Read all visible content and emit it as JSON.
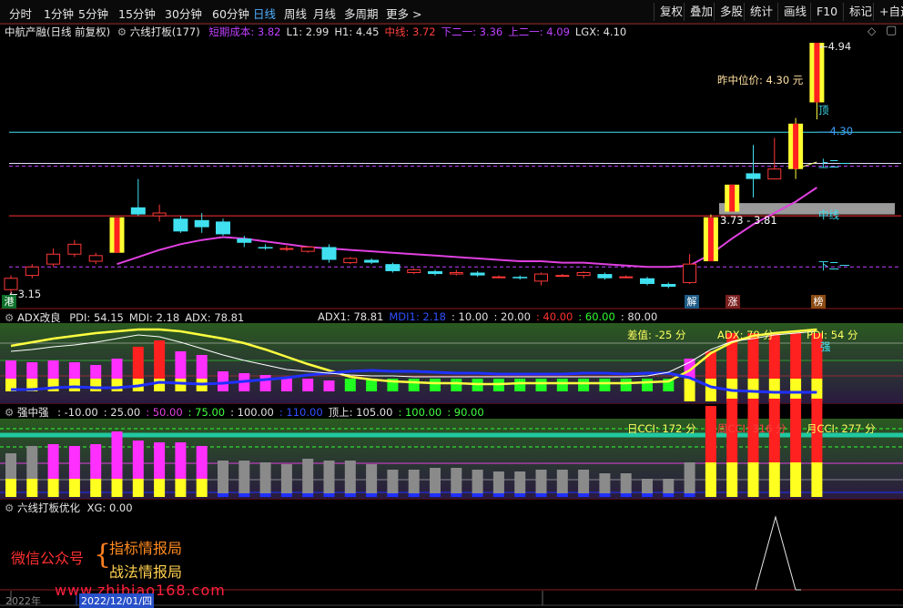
{
  "toolbar": {
    "periods": [
      "分时",
      "1分钟",
      "5分钟",
      "15分钟",
      "30分钟",
      "60分钟",
      "日线",
      "周线",
      "月线",
      "多周期",
      "更多 >"
    ],
    "active_period": "日线",
    "right_buttons": [
      "复权",
      "叠加",
      "多股",
      "统计",
      "画线",
      "F10",
      "标记",
      "+自选"
    ]
  },
  "main_panel": {
    "stock_title": "中航产融(日线 前复权)",
    "indicator_name": "六线打板(177)",
    "params": [
      {
        "text": "短期成本: 3.82",
        "color": "#c040ff"
      },
      {
        "text": "L1: 2.99",
        "color": "#e0e0e0"
      },
      {
        "text": "H1: 4.45",
        "color": "#e0e0e0"
      },
      {
        "text": "中线: 3.72",
        "color": "#ff4040"
      },
      {
        "text": "下二一: 3.36",
        "color": "#c040ff"
      },
      {
        "text": "上二一: 4.09",
        "color": "#c040ff"
      },
      {
        "text": "LGX: 4.10",
        "color": "#e0e0e0"
      }
    ],
    "high_label": "4.94",
    "low_label": "3.15",
    "mid_price_label": "昨中位价:  4.30 元",
    "top_label": "顶",
    "level_430": "---4.30",
    "upper_label": "上二一",
    "mid_label": "中线",
    "lower_label": "下二一",
    "range_label": "3.73 - 3.81",
    "badge_left": "港",
    "badges": [
      "解",
      "涨",
      "榜"
    ]
  },
  "adx_panel": {
    "name": "ADX改良",
    "values": [
      {
        "text": "PDI: 54.15",
        "color": "#e0e0e0"
      },
      {
        "text": "MDI: 2.18",
        "color": "#e0e0e0"
      },
      {
        "text": "ADX: 78.81",
        "color": "#e0e0e0"
      }
    ],
    "levels": [
      {
        "text": "ADX1: 78.81",
        "color": "#e0e0e0"
      },
      {
        "text": "MDI1: 2.18",
        "color": "#3050ff"
      },
      {
        "text": ": 10.00",
        "color": "#e0e0e0"
      },
      {
        "text": ": 20.00",
        "color": "#e0e0e0"
      },
      {
        "text": ": 40.00",
        "color": "#ff3030"
      },
      {
        "text": ": 60.00",
        "color": "#30ff30"
      },
      {
        "text": ": 80.00",
        "color": "#e0e0e0"
      }
    ],
    "diff_label": "差值: -25 分",
    "adx_score": "ADX: 79 分",
    "pdi_score": "PDI: 54 分",
    "strong": "强"
  },
  "cci_panel": {
    "name": "强中强",
    "levels": [
      {
        "text": ": -10.00",
        "color": "#e0e0e0"
      },
      {
        "text": ": 25.00",
        "color": "#e0e0e0"
      },
      {
        "text": ": 50.00",
        "color": "#e040e0"
      },
      {
        "text": ": 75.00",
        "color": "#40ff40"
      },
      {
        "text": ": 100.00",
        "color": "#e0e0e0"
      },
      {
        "text": ": 110.00",
        "color": "#3050ff"
      },
      {
        "text": "顶上: 105.00",
        "color": "#e0e0e0"
      },
      {
        "text": ": 100.00",
        "color": "#40ff40"
      },
      {
        "text": ": 90.00",
        "color": "#40ff40"
      }
    ],
    "day_cci": "日CCI: 172 分",
    "week_cci": "周CCI: 316 分",
    "month_cci": "月CCI: 277 分"
  },
  "xg_panel": {
    "name": "六线打板优化",
    "value": "XG: 0.00",
    "watermark_left": "微信公众号",
    "watermark_right1": "指标情报局",
    "watermark_right2": "战法情报局",
    "watermark_url": "www.zhibiao168.com"
  },
  "date_axis": {
    "year": "2022年",
    "date": "2022/12/01/四"
  },
  "colors": {
    "up": "#ff3838",
    "down": "#40e0f0",
    "magenta": "#ff30ff",
    "yellow": "#ffff20",
    "green": "#20ff20"
  }
}
